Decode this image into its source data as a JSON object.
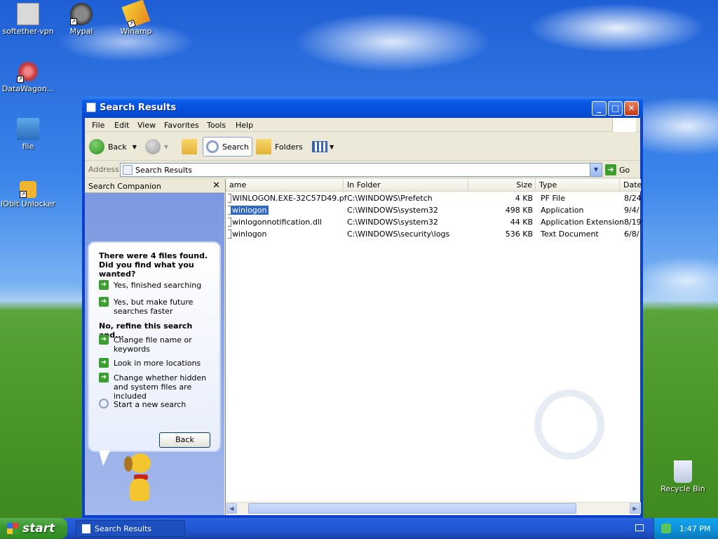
{
  "desktop": {
    "icons": [
      {
        "label": "softether-vpn"
      },
      {
        "label": "Mypal"
      },
      {
        "label": "Winamp"
      },
      {
        "label": "DataWagon..."
      },
      {
        "label": "file"
      },
      {
        "label": "IObit Unlocker"
      },
      {
        "label": "Recycle Bin"
      }
    ]
  },
  "window": {
    "title": "Search Results",
    "menu": [
      "File",
      "Edit",
      "View",
      "Favorites",
      "Tools",
      "Help"
    ],
    "toolbar": {
      "back": "Back",
      "search": "Search",
      "folders": "Folders"
    },
    "address": {
      "label": "Address",
      "value": "Search Results",
      "go": "Go"
    },
    "companion": {
      "title": "Search Companion",
      "message": "There were 4 files found. Did you find what you wanted?",
      "yes_finished": "Yes, finished searching",
      "yes_faster": "Yes, but make future searches faster",
      "refine_heading": "No, refine this search and...",
      "refine_name": "Change file name or keywords",
      "refine_locations": "Look in more locations",
      "refine_hidden": "Change whether hidden and system files are included",
      "new_search": "Start a new search",
      "back_button": "Back"
    },
    "columns": [
      "ame",
      "In Folder",
      "Size",
      "Type",
      "Date"
    ],
    "files": [
      {
        "name": "WINLOGON.EXE-32C57D49.pf",
        "folder": "C:\\WINDOWS\\Prefetch",
        "size": "4 KB",
        "type": "PF File",
        "date": "8/24"
      },
      {
        "name": "winlogon",
        "folder": "C:\\WINDOWS\\system32",
        "size": "498 KB",
        "type": "Application",
        "date": "9/4/"
      },
      {
        "name": "winlogonnotification.dll",
        "folder": "C:\\WINDOWS\\system32",
        "size": "44 KB",
        "type": "Application Extension",
        "date": "8/19"
      },
      {
        "name": "winlogon",
        "folder": "C:\\WINDOWS\\security\\logs",
        "size": "536 KB",
        "type": "Text Document",
        "date": "6/8/"
      }
    ]
  },
  "taskbar": {
    "start": "start",
    "task": "Search Results",
    "clock": "1:47 PM"
  }
}
